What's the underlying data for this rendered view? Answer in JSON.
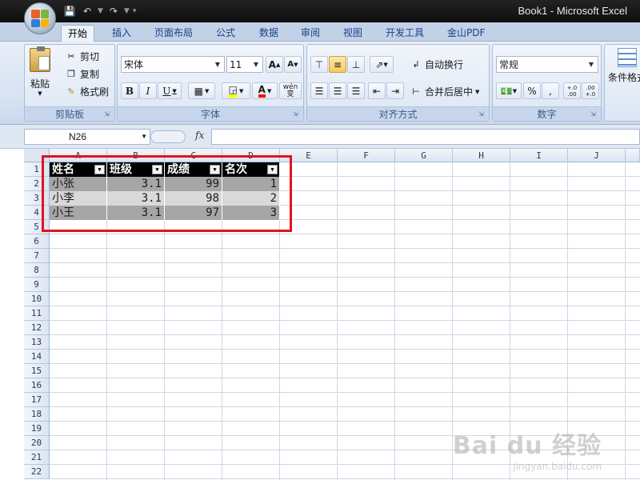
{
  "window": {
    "title": "Book1 - Microsoft Excel"
  },
  "ribbon_tabs": [
    "开始",
    "插入",
    "页面布局",
    "公式",
    "数据",
    "审阅",
    "视图",
    "开发工具",
    "金山PDF"
  ],
  "clipboard": {
    "paste": "粘贴",
    "cut": "剪切",
    "copy": "复制",
    "format_painter": "格式刷",
    "label": "剪贴板"
  },
  "font": {
    "name": "宋体",
    "size": "11",
    "grow": "A",
    "shrink": "A",
    "bold": "B",
    "italic": "I",
    "underline": "U",
    "phonetic": "wén 变",
    "label": "字体",
    "fill_color": "#ffff00",
    "font_color": "#ff0000"
  },
  "alignment": {
    "wrap_text": "自动换行",
    "merge_center": "合并后居中",
    "label": "对齐方式"
  },
  "number": {
    "format": "常规",
    "percent": "%",
    "comma": ",",
    "inc_decimal": "+.0 .00",
    "dec_decimal": ".00 +.0",
    "label": "数字"
  },
  "styles": {
    "conditional_format": "条件格式"
  },
  "formula_bar": {
    "name_box": "N26",
    "fx": "fx",
    "value": ""
  },
  "columns": [
    "A",
    "B",
    "C",
    "D",
    "E",
    "F",
    "G",
    "H",
    "I",
    "J"
  ],
  "rows": [
    "1",
    "2",
    "3",
    "4",
    "5",
    "6",
    "7",
    "8",
    "9",
    "10",
    "11",
    "12",
    "13",
    "14",
    "15",
    "16",
    "17",
    "18",
    "19",
    "20",
    "21",
    "22"
  ],
  "table": {
    "headers": [
      "姓名",
      "班级",
      "成绩",
      "名次"
    ],
    "rows": [
      [
        "小张",
        "3.1",
        "99",
        "1"
      ],
      [
        "小李",
        "3.1",
        "98",
        "2"
      ],
      [
        "小王",
        "3.1",
        "97",
        "3"
      ]
    ]
  },
  "colors": {
    "highlight": "#e0131e",
    "header_bg": "#000000",
    "band_dark": "#a6a6a6",
    "band_light": "#d9d9d9"
  },
  "watermark": {
    "main": "Bai du 经验",
    "sub": "jingyan.baidu.com"
  }
}
